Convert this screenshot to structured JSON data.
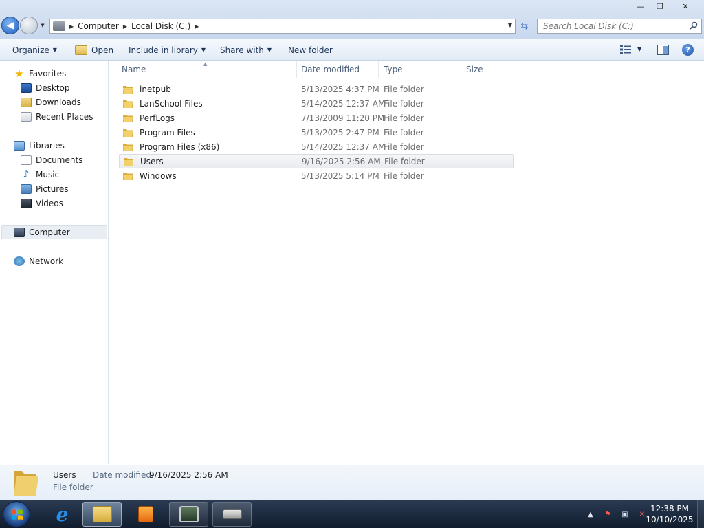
{
  "window": {
    "controls": {
      "minimize": "—",
      "maximize": "❐",
      "close": "✕"
    }
  },
  "address": {
    "crumbs": [
      "Computer",
      "Local Disk (C:)"
    ],
    "search_placeholder": "Search Local Disk (C:)"
  },
  "toolbar": {
    "organize": "Organize",
    "open": "Open",
    "include_in_library": "Include in library",
    "share_with": "Share with",
    "new_folder": "New folder"
  },
  "navpane": {
    "favorites": "Favorites",
    "favorites_items": [
      "Desktop",
      "Downloads",
      "Recent Places"
    ],
    "libraries": "Libraries",
    "libraries_items": [
      "Documents",
      "Music",
      "Pictures",
      "Videos"
    ],
    "computer": "Computer",
    "network": "Network"
  },
  "columns": {
    "name": "Name",
    "date": "Date modified",
    "type": "Type",
    "size": "Size"
  },
  "files": [
    {
      "name": "inetpub",
      "date": "5/13/2025 4:37 PM",
      "type": "File folder"
    },
    {
      "name": "LanSchool Files",
      "date": "5/14/2025 12:37 AM",
      "type": "File folder"
    },
    {
      "name": "PerfLogs",
      "date": "7/13/2009 11:20 PM",
      "type": "File folder"
    },
    {
      "name": "Program Files",
      "date": "5/13/2025 2:47 PM",
      "type": "File folder"
    },
    {
      "name": "Program Files (x86)",
      "date": "5/14/2025 12:37 AM",
      "type": "File folder"
    },
    {
      "name": "Users",
      "date": "9/16/2025 2:56 AM",
      "type": "File folder"
    },
    {
      "name": "Windows",
      "date": "5/13/2025 5:14 PM",
      "type": "File folder"
    }
  ],
  "selected_index": 5,
  "details": {
    "name": "Users",
    "date_label": "Date modified:",
    "date_value": "9/16/2025 2:56 AM",
    "type": "File folder"
  },
  "taskbar": {
    "apps": [
      "internet-explorer",
      "windows-explorer",
      "media-player",
      "remote-desktop",
      "scanner"
    ],
    "clock_time": "12:38 PM",
    "clock_date": "10/10/2025"
  },
  "colors": {
    "folder": "#e8c35a",
    "selection": "#e9ebef",
    "accent": "#1e3559"
  }
}
